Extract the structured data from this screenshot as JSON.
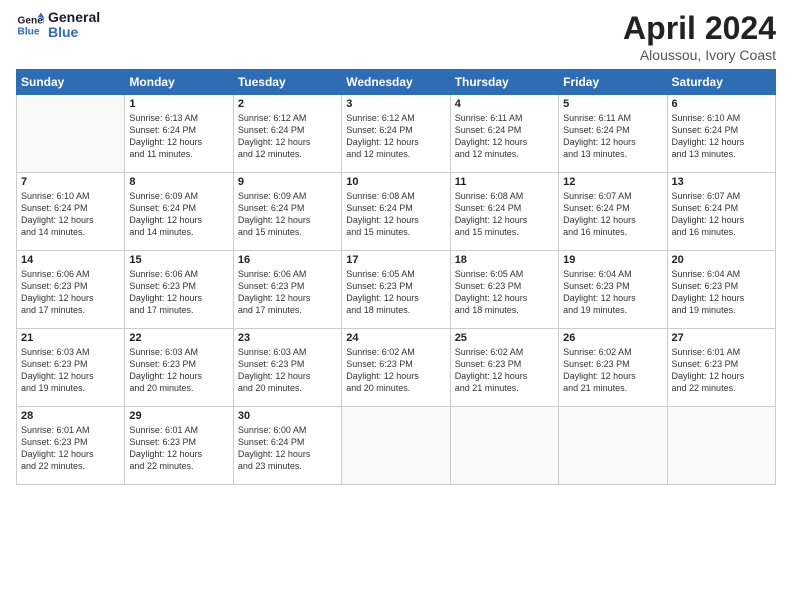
{
  "logo": {
    "line1": "General",
    "line2": "Blue"
  },
  "title": "April 2024",
  "subtitle": "Aloussou, Ivory Coast",
  "days": [
    "Sunday",
    "Monday",
    "Tuesday",
    "Wednesday",
    "Thursday",
    "Friday",
    "Saturday"
  ],
  "weeks": [
    [
      {
        "date": "",
        "content": ""
      },
      {
        "date": "1",
        "content": "Sunrise: 6:13 AM\nSunset: 6:24 PM\nDaylight: 12 hours\nand 11 minutes."
      },
      {
        "date": "2",
        "content": "Sunrise: 6:12 AM\nSunset: 6:24 PM\nDaylight: 12 hours\nand 12 minutes."
      },
      {
        "date": "3",
        "content": "Sunrise: 6:12 AM\nSunset: 6:24 PM\nDaylight: 12 hours\nand 12 minutes."
      },
      {
        "date": "4",
        "content": "Sunrise: 6:11 AM\nSunset: 6:24 PM\nDaylight: 12 hours\nand 12 minutes."
      },
      {
        "date": "5",
        "content": "Sunrise: 6:11 AM\nSunset: 6:24 PM\nDaylight: 12 hours\nand 13 minutes."
      },
      {
        "date": "6",
        "content": "Sunrise: 6:10 AM\nSunset: 6:24 PM\nDaylight: 12 hours\nand 13 minutes."
      }
    ],
    [
      {
        "date": "7",
        "content": "Sunrise: 6:10 AM\nSunset: 6:24 PM\nDaylight: 12 hours\nand 14 minutes."
      },
      {
        "date": "8",
        "content": "Sunrise: 6:09 AM\nSunset: 6:24 PM\nDaylight: 12 hours\nand 14 minutes."
      },
      {
        "date": "9",
        "content": "Sunrise: 6:09 AM\nSunset: 6:24 PM\nDaylight: 12 hours\nand 15 minutes."
      },
      {
        "date": "10",
        "content": "Sunrise: 6:08 AM\nSunset: 6:24 PM\nDaylight: 12 hours\nand 15 minutes."
      },
      {
        "date": "11",
        "content": "Sunrise: 6:08 AM\nSunset: 6:24 PM\nDaylight: 12 hours\nand 15 minutes."
      },
      {
        "date": "12",
        "content": "Sunrise: 6:07 AM\nSunset: 6:24 PM\nDaylight: 12 hours\nand 16 minutes."
      },
      {
        "date": "13",
        "content": "Sunrise: 6:07 AM\nSunset: 6:24 PM\nDaylight: 12 hours\nand 16 minutes."
      }
    ],
    [
      {
        "date": "14",
        "content": "Sunrise: 6:06 AM\nSunset: 6:23 PM\nDaylight: 12 hours\nand 17 minutes."
      },
      {
        "date": "15",
        "content": "Sunrise: 6:06 AM\nSunset: 6:23 PM\nDaylight: 12 hours\nand 17 minutes."
      },
      {
        "date": "16",
        "content": "Sunrise: 6:06 AM\nSunset: 6:23 PM\nDaylight: 12 hours\nand 17 minutes."
      },
      {
        "date": "17",
        "content": "Sunrise: 6:05 AM\nSunset: 6:23 PM\nDaylight: 12 hours\nand 18 minutes."
      },
      {
        "date": "18",
        "content": "Sunrise: 6:05 AM\nSunset: 6:23 PM\nDaylight: 12 hours\nand 18 minutes."
      },
      {
        "date": "19",
        "content": "Sunrise: 6:04 AM\nSunset: 6:23 PM\nDaylight: 12 hours\nand 19 minutes."
      },
      {
        "date": "20",
        "content": "Sunrise: 6:04 AM\nSunset: 6:23 PM\nDaylight: 12 hours\nand 19 minutes."
      }
    ],
    [
      {
        "date": "21",
        "content": "Sunrise: 6:03 AM\nSunset: 6:23 PM\nDaylight: 12 hours\nand 19 minutes."
      },
      {
        "date": "22",
        "content": "Sunrise: 6:03 AM\nSunset: 6:23 PM\nDaylight: 12 hours\nand 20 minutes."
      },
      {
        "date": "23",
        "content": "Sunrise: 6:03 AM\nSunset: 6:23 PM\nDaylight: 12 hours\nand 20 minutes."
      },
      {
        "date": "24",
        "content": "Sunrise: 6:02 AM\nSunset: 6:23 PM\nDaylight: 12 hours\nand 20 minutes."
      },
      {
        "date": "25",
        "content": "Sunrise: 6:02 AM\nSunset: 6:23 PM\nDaylight: 12 hours\nand 21 minutes."
      },
      {
        "date": "26",
        "content": "Sunrise: 6:02 AM\nSunset: 6:23 PM\nDaylight: 12 hours\nand 21 minutes."
      },
      {
        "date": "27",
        "content": "Sunrise: 6:01 AM\nSunset: 6:23 PM\nDaylight: 12 hours\nand 22 minutes."
      }
    ],
    [
      {
        "date": "28",
        "content": "Sunrise: 6:01 AM\nSunset: 6:23 PM\nDaylight: 12 hours\nand 22 minutes."
      },
      {
        "date": "29",
        "content": "Sunrise: 6:01 AM\nSunset: 6:23 PM\nDaylight: 12 hours\nand 22 minutes."
      },
      {
        "date": "30",
        "content": "Sunrise: 6:00 AM\nSunset: 6:24 PM\nDaylight: 12 hours\nand 23 minutes."
      },
      {
        "date": "",
        "content": ""
      },
      {
        "date": "",
        "content": ""
      },
      {
        "date": "",
        "content": ""
      },
      {
        "date": "",
        "content": ""
      }
    ]
  ]
}
